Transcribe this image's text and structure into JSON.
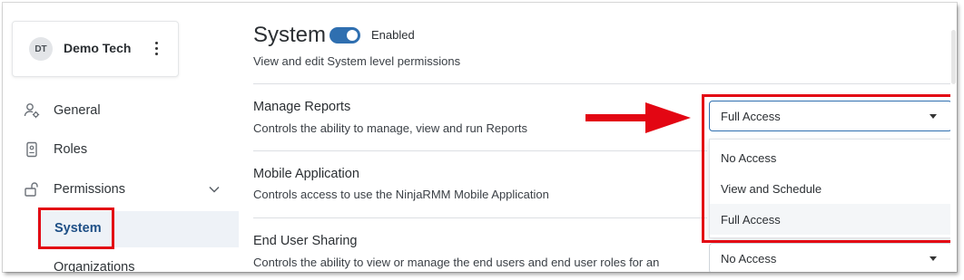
{
  "user": {
    "initials": "DT",
    "name": "Demo Tech"
  },
  "sidebar": {
    "items": [
      {
        "label": "General",
        "icon": "user-gear-icon"
      },
      {
        "label": "Roles",
        "icon": "id-badge-icon"
      },
      {
        "label": "Permissions",
        "icon": "unlock-icon"
      }
    ],
    "subitems": [
      {
        "label": "System",
        "active": true
      },
      {
        "label": "Organizations"
      }
    ]
  },
  "header": {
    "title": "System",
    "toggle_label": "Enabled",
    "toggle_on": true,
    "subtitle": "View and edit System level permissions"
  },
  "permissions": [
    {
      "title": "Manage Reports",
      "description": "Controls the ability to manage, view and run Reports",
      "value": "Full Access",
      "open": true
    },
    {
      "title": "Mobile Application",
      "description": "Controls access to use the NinjaRMM Mobile Application",
      "value": ""
    },
    {
      "title": "End User Sharing",
      "description": "Controls the ability to view or manage the end users and end user roles for an",
      "value": "No Access"
    }
  ],
  "dropdown": {
    "options": [
      "No Access",
      "View and Schedule",
      "Full Access"
    ],
    "highlighted": "Full Access"
  },
  "colors": {
    "accent": "#2f6fb0",
    "annotation": "#e30613",
    "active_bg": "#eef2f7",
    "active_text": "#1e4f86"
  }
}
